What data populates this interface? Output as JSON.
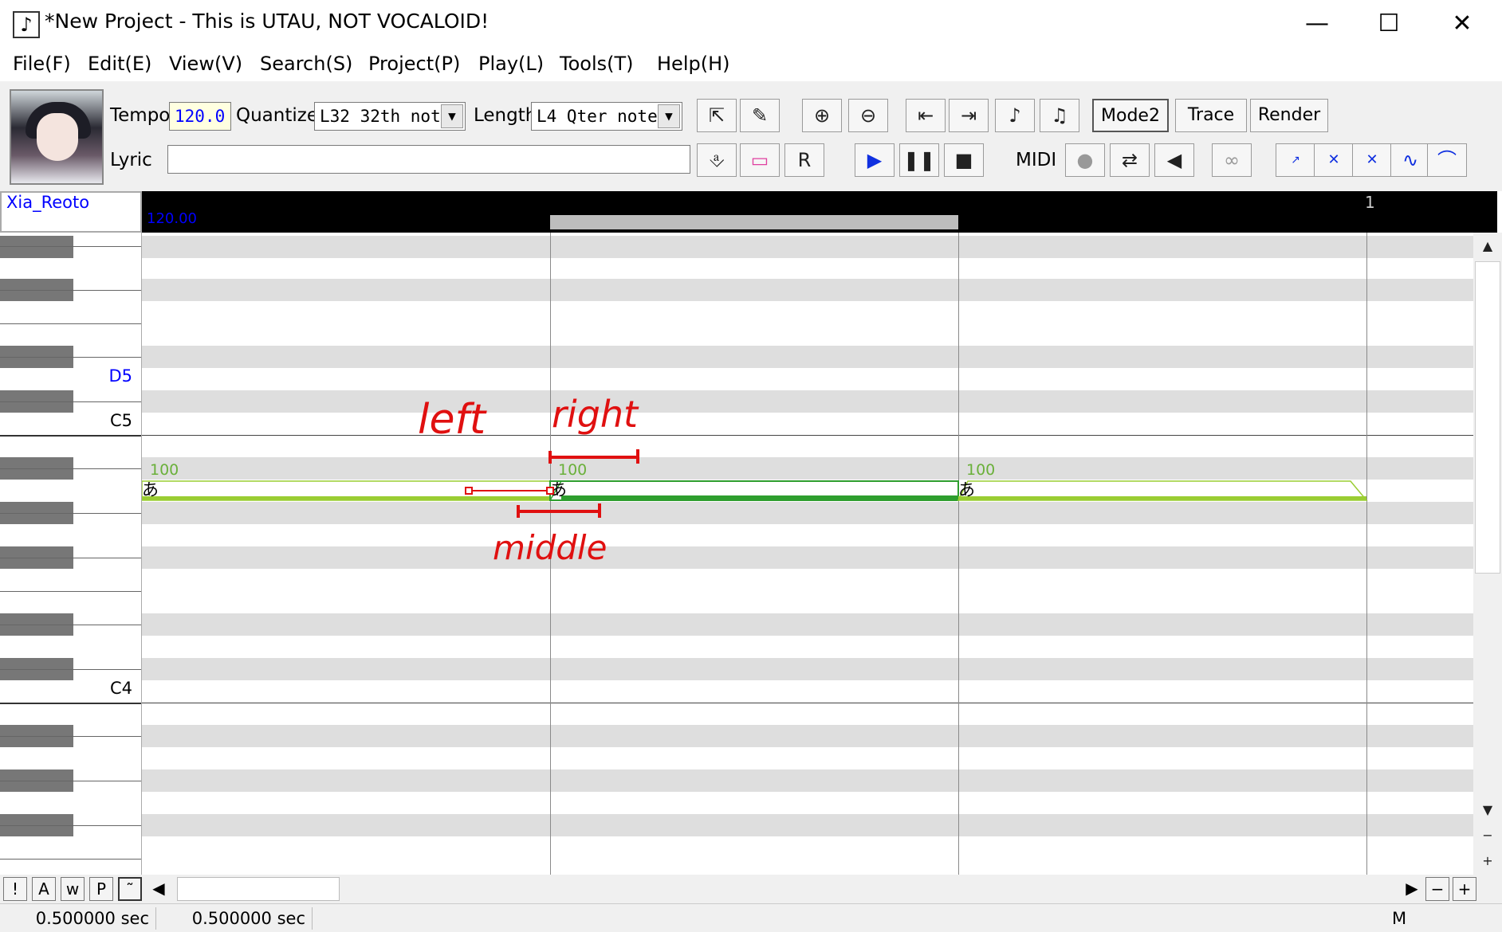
{
  "window": {
    "icon": "♪",
    "title": "*New Project - This is UTAU, NOT VOCALOID!",
    "minimize": "—",
    "maximize": "☐",
    "close": "✕"
  },
  "menu": [
    "File(F)",
    "Edit(E)",
    "View(V)",
    "Search(S)",
    "Project(P)",
    "Play(L)",
    "Tools(T)",
    "Help(H)"
  ],
  "toolbar": {
    "tempo_label": "Tempo",
    "tempo_value": "120.0",
    "quantize_label": "Quantize",
    "quantize_value": "L32 32th note",
    "length_label": "Length",
    "length_value": "L4  Qter note",
    "lyric_label": "Lyric",
    "lyric_value": "",
    "mode2_label": "Mode2",
    "trace_label": "Trace",
    "render_label": "Render",
    "midi_label": "MIDI"
  },
  "track": {
    "singer": "Xia_Reoto",
    "tempo_marker": "120.00",
    "measure": "1"
  },
  "piano_labels": {
    "d5": "D5",
    "c5": "C5",
    "c4": "C4"
  },
  "notes": [
    {
      "lyric": "あ",
      "velocity": "100"
    },
    {
      "lyric": "あ",
      "velocity": "100"
    },
    {
      "lyric": "あ",
      "velocity": "100"
    }
  ],
  "annotations": {
    "left": "left",
    "right": "right",
    "middle": "middle"
  },
  "bottom_buttons": [
    "!",
    "A",
    "w",
    "P",
    "˜"
  ],
  "status": {
    "time1": "0.500000 sec",
    "time2": "0.500000 sec",
    "mode": "M"
  },
  "colors": {
    "note_light_green": "#9acd32",
    "note_dark_green": "#2e9e2e",
    "velocity_green": "#6ab03a",
    "annotation_red": "#e01010",
    "tempo_blue": "#0000ff"
  }
}
